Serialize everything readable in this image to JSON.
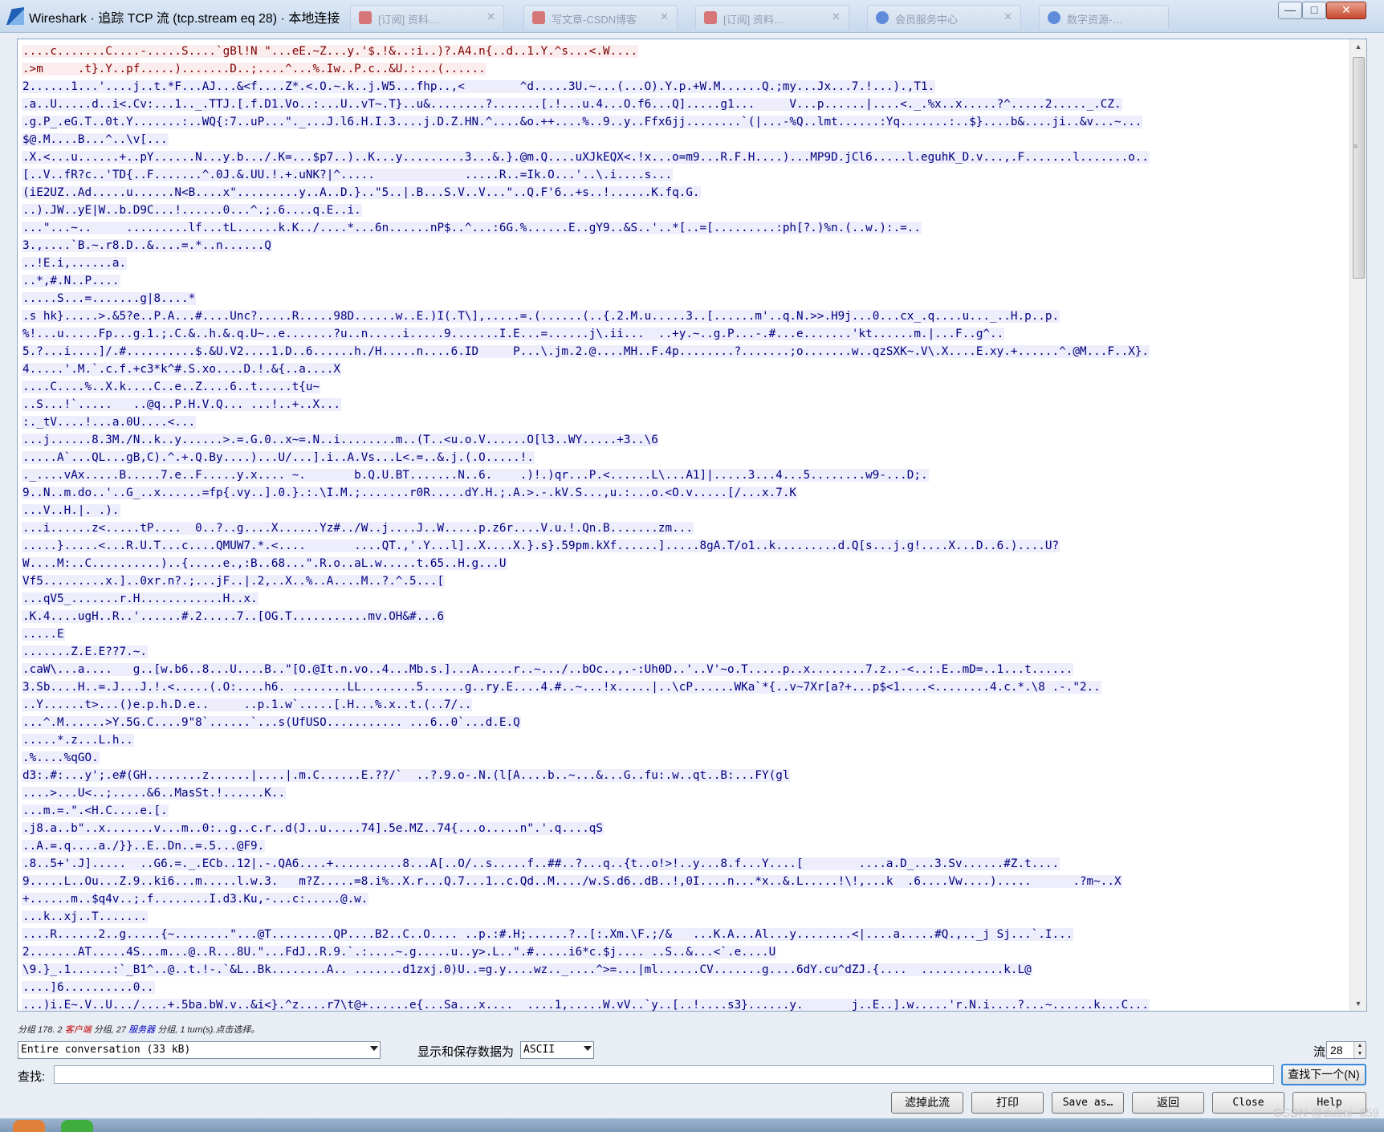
{
  "window": {
    "title": "Wireshark · 追踪 TCP 流 (tcp.stream eq 28) · 本地连接",
    "background_tabs": [
      {
        "label": "[订阅] 资料…",
        "color": "#d9534f"
      },
      {
        "label": "写文章-CSDN博客",
        "color": "#d9534f"
      },
      {
        "label": "[订阅] 资料…",
        "color": "#d9534f"
      },
      {
        "label": "会员服务中心",
        "color": "#3b6fd4"
      },
      {
        "label": "数字资源-…",
        "color": "#3b6fd4"
      }
    ],
    "buttons": {
      "minimize": "—",
      "maximize": "□",
      "close": "✕"
    }
  },
  "colors": {
    "client_bg": "#fbeded",
    "client_fg": "#7f0000",
    "server_bg": "#ededfb",
    "server_fg": "#00007f"
  },
  "stream": {
    "lines": [
      {
        "dir": "client",
        "text": "....c.......C....-.....S....`gBl!N \"...eE.~Z...y.'$.!&..:i..)?.A4.n{..d..1.Y.^s...<.W...."
      },
      {
        "dir": "client",
        "text": ".>m     .t}.Y..pf.....).......D..;....^...%.Iw..P.c..&U.:...(......"
      },
      {
        "dir": "server",
        "text": "2......1...'....j..t.*F...AJ...&<f....Z*.<.O.~.k..j.W5...fhp..,<        ^d.....3U.~...(...O).Y.p.+W.M......Q.;my...Jx...7.!...).,T1."
      },
      {
        "dir": "server",
        "text": ".a..U.....d..i<.Cv:...1.._.TTJ.[.f.D1.Vo..:...U..vT~.T}..u&........?.......[.!...u.4...O.f6...Q].....g1...     V...p......|....<._.%x..x.....?^.....2....._.CZ."
      },
      {
        "dir": "server",
        "text": ".g.P_.eG.T..0t.Y.......:..WQ{:7..uP...\"._...J.l6.H.I.3....j.D.Z.HN.^....&o.++....%..9..y..Ffx6jj........`(|...-%Q..lmt......:Yq.......:..$}....b&....ji..&v...~..."
      },
      {
        "dir": "server",
        "text": "$@.M....B...^..\\v[..."
      },
      {
        "dir": "server",
        "text": ".X.<...u......+..pY......N...y.b.../.K=...$p7..)..K...y.........3...&.}.@m.Q....uXJkEQX<.!x...o=m9...R.F.H....)...MP9D.jCl6.....l.eguhK_D.v...,.F.......l.......o.."
      },
      {
        "dir": "server",
        "text": "[..V..fR?c..'TD{..F.......^.0J.&.UU.!.+.uNK?|^.....             .....R..=Ik.O...'..\\.i....s..."
      },
      {
        "dir": "server",
        "text": "(iE2UZ..Ad.....u......N<B....x\".........y..A..D.}..\"5..|.B...S.V..V...\"..Q.F'6..+s..!......K.fq.G."
      },
      {
        "dir": "server",
        "text": "..).JW..yE|W..b.D9C...!......0...^.;.6....q.E..i."
      },
      {
        "dir": "server",
        "text": "...\"...~..     .........lf...tL......k.K../....*...6n......nP$..^...:6G.%......E..gY9..&S..'..*[..=[.........:ph[?.)%n.(..w.):.=.."
      },
      {
        "dir": "server",
        "text": "3.,....`B.~.r8.D..&....=.*..n......Q"
      },
      {
        "dir": "server",
        "text": "..!E.i,......a."
      },
      {
        "dir": "server",
        "text": "..*,#.N..P...."
      },
      {
        "dir": "server",
        "text": ".....S...=.......g|8....*"
      },
      {
        "dir": "server",
        "text": ".s hk}.....>.&5?e..P.A...#....Unc?.....R.....98D......w..E.)I(.T\\],.....=.(......(..{.2.M.u.....3..[......m'..q.N.>>.H9j...0...cx_.q....u..._..H.p..p."
      },
      {
        "dir": "server",
        "text": "%!...u.....Fp...g.1.;.C.&..h.&.q.U~..e.......?u..n.....i.....9.......I.E...=......j\\.ii...  ..+y.~..g.P...-.#...e.......'kt......m.|...F..g^.."
      },
      {
        "dir": "server",
        "text": "5.?...i....]/.#..........$.&U.V2....1.D..6......h./H.....n....6.ID     P...\\.jm.2.@....MH..F.4p........?.......;o.......w..qzSXK~.V\\.X....E.xy.+......^.@M...F..X}."
      },
      {
        "dir": "server",
        "text": "4.....'.M.`.c.f.+c3*k^#.S.xo....D.!.&{..a....X"
      },
      {
        "dir": "server",
        "text": "....C....%..X.k....C..e..Z....6..t.....t{u~"
      },
      {
        "dir": "server",
        "text": "..S...!`.....   ..@q..P.H.V.Q... ...!..+..X..."
      },
      {
        "dir": "server",
        "text": ":._tV....!...a.0U....<..."
      },
      {
        "dir": "server",
        "text": "...j......8.3M./N..k..y......>.=.G.0..x~=.N..i........m..(T..<u.o.V......O[l3..WY.....+3..\\6"
      },
      {
        "dir": "server",
        "text": ".....A`...QL...gB,C).^.+.Q.By....)...U/...].i..A.Vs...L<.=..&.j.(.O.....!."
      },
      {
        "dir": "server",
        "text": "._....vAx.....B.....7.e..F.....y.x.... ~.       b.Q.U.BT.......N..6.    .)!.)qr...P.<......L\\...A1]|.....3...4...5........w9-...D;."
      },
      {
        "dir": "server",
        "text": "9..N..m.do..'..G_..x......=fp{.vy..].0.}.:.\\I.M.;.......r0R.....dY.H.;.A.>.-.kV.S...,u.:...o.<O.v.....[/...x.7.K"
      },
      {
        "dir": "server",
        "text": "...V..H.|. .)."
      },
      {
        "dir": "server",
        "text": "...i......z<.....tP....  0..?..g....X......Yz#../W..j....J..W.....p.z6r....V.u.!.Qn.B.......zm..."
      },
      {
        "dir": "server",
        "text": ".....}.....<...R.U.T...c....QMUW7.*.<....       ....QT.,'.Y...l]..X....X.}.s}.59pm.kXf......].....8gA.T/o1..k.........d.Q[s...j.g!....X...D..6.)....U?"
      },
      {
        "dir": "server",
        "text": "W....M:..C..........)..{.....e.,:B..68...\".R.o..aL.w.....t.65..H.g...U"
      },
      {
        "dir": "server",
        "text": "Vf5.........x.]..0xr.n?.;...jF..|.2,..X..%..A....M..?.^.5...["
      },
      {
        "dir": "server",
        "text": "...qV5_.......r.H............H..x."
      },
      {
        "dir": "server",
        "text": ".K.4....ugH..R..'......#.2.....7..[OG.T...........mv.OH&#...6"
      },
      {
        "dir": "server",
        "text": ".....E"
      },
      {
        "dir": "server",
        "text": ".......Z.E.E??7.~."
      },
      {
        "dir": "server",
        "text": ".caW\\...a....   g..[w.b6..8...U....B..\"[O.@It.n.vo..4...Mb.s.]...A.....r..~.../..bOc..,.-:Uh0D..'..V'~o.T.....p..x........7.z..-<..:.E..mD=..1...t......"
      },
      {
        "dir": "server",
        "text": "3.Sb....H..=.J...J.!.<.....(.O:....h6. ........LL........5......g..ry.E....4.#..~...!x.....|..\\cP......WKa`*{..v~7Xr[a?+...p$<1....<........4.c.*.\\8 .-.\"2.."
      },
      {
        "dir": "server",
        "text": "..Y......t>...()e.p.h.D.e..     ..p.1.w`.....[.H...%.x..t.(..7/.."
      },
      {
        "dir": "server",
        "text": "...^.M......>Y.5G.C....9\"8`......`...s(UfUSO........... ...6..0`...d.E.Q"
      },
      {
        "dir": "server",
        "text": ".....*.z...L.h.."
      },
      {
        "dir": "server",
        "text": ".%....%qGO."
      },
      {
        "dir": "server",
        "text": "d3:.#:...y';.e#(GH........z......|....|.m.C......E.??/`  ..?.9.o-.N.(l[A....b..~...&...G..fu:.w..qt..B:...FY(gl"
      },
      {
        "dir": "server",
        "text": "....>...U<..;.....&6..MasSt.!......K.."
      },
      {
        "dir": "server",
        "text": "...m.=.\".<H.C....e.[."
      },
      {
        "dir": "server",
        "text": ".j8.a..b\"..x.......v...m..0:..g..c.r..d(J..u.....74].5e.MZ..74{...o.....n\".'.q....qS"
      },
      {
        "dir": "server",
        "text": "..A.=.q....a./}}..E..Dn..=.5...@F9."
      },
      {
        "dir": "server",
        "text": ".8..5+'.J].....  ..G6.=._.ECb..12|.-.QA6....+..........8...A[..O/..s.....f..##..?...q..{t..o!>!..y...8.f...Y....[        ....a.D_...3.Sv......#Z.t...."
      },
      {
        "dir": "server",
        "text": "9.....L..Ou...Z.9..ki6...m.....l.w.3.   m?Z.....=8.i%..X.r...Q.7...1..c.Qd..M..../w.S.d6..dB..!,0I....n...*x..&.L.....!\\!,...k  .6....Vw....).....      .?m~..X"
      },
      {
        "dir": "server",
        "text": "+......m..$q4v..;.f........I.d3.Ku,-...c:.....@.w."
      },
      {
        "dir": "server",
        "text": "...k..xj..T......."
      },
      {
        "dir": "server",
        "text": "....R......2..g.....{~........\"...@T.........QP....B2..C..O.... ..p.:#.H;......?..[:.Xm.\\F.;/&   ...K.A...Al...y........<|....a.....#Q.,.._j Sj...`.I..."
      },
      {
        "dir": "server",
        "text": "2.......AT.....4S...m...@..R...8U.\"...FdJ..R.9.`.:....~.g.....u..y>.L..\".#.....i6*c.$j.... ..S..&...<`.e....U"
      },
      {
        "dir": "server",
        "text": "\\9.}_.1......:`_B1^..@..t.!-.`&L..Bk........A.. .......d1zxj.0)U..=g.y....wz.._....^>=...|ml......CV.......g....6dY.cu^dZJ.{....  ............k.L@"
      },
      {
        "dir": "server",
        "text": "....]6..........0.."
      },
      {
        "dir": "server",
        "text": "...)i.E~.V..U.../....+.5ba.bW.v..&i<}.^z....r7\\t@+......e{...Sa...x....  ....1,.....W.vV..`y..[..!....s3}......y.       j..E..].w.....'r.N.i....?...~......k...C..."
      }
    ]
  },
  "status": {
    "prefix": "分组 178. 2 ",
    "client": "客户端",
    "middle": " 分组, 27 ",
    "server": "服务器",
    "suffix": " 分组, 1 turn(s).点击选择。"
  },
  "controls": {
    "conversation": "Entire conversation (33 kB)",
    "show_as_label": "显示和保存数据为",
    "encoding": "ASCII",
    "stream_label": "流",
    "stream_number": "28",
    "find_label": "查找:",
    "find_value": "",
    "find_next": "查找下一个(N)"
  },
  "buttons": {
    "filter_out": "滤掉此流",
    "print": "打印",
    "save_as": "Save as…",
    "back": "返回",
    "close": "Close",
    "help": "Help"
  },
  "watermark": "CSDN @dubai_659"
}
